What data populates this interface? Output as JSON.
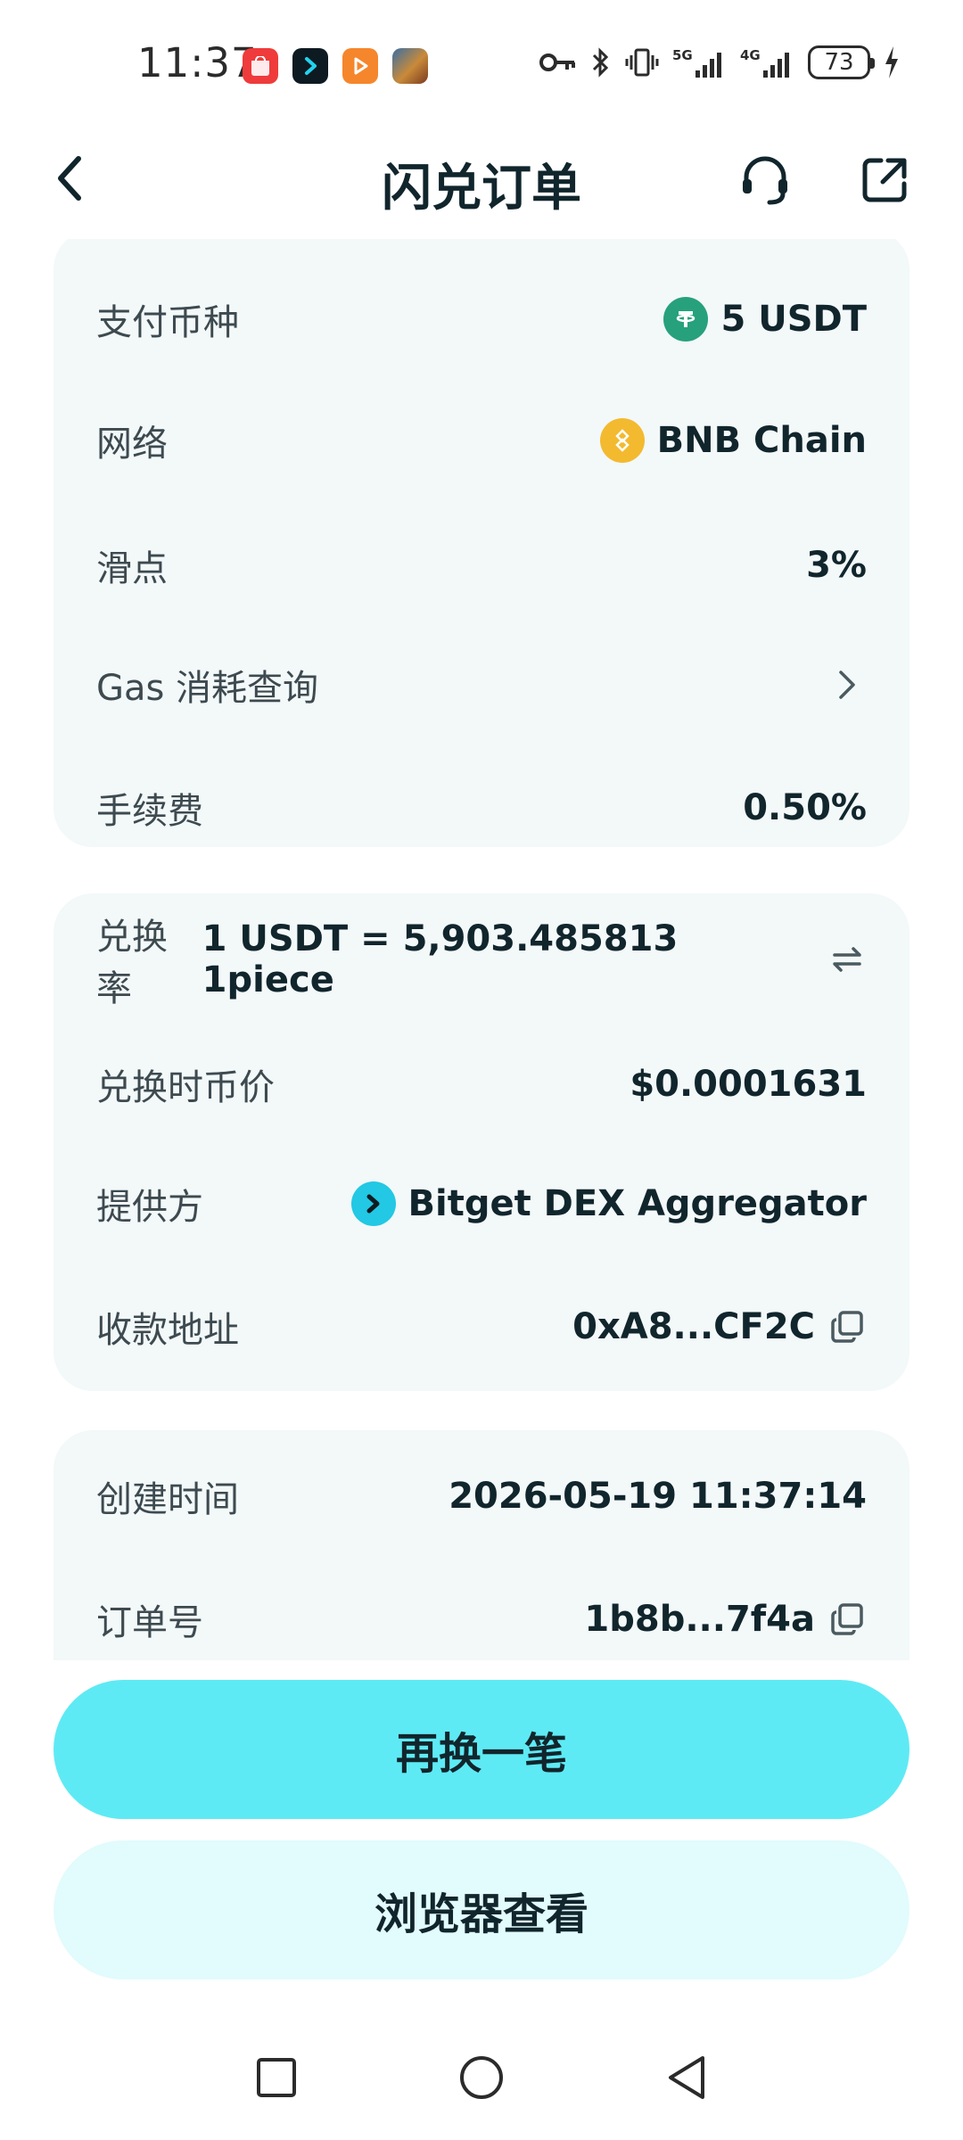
{
  "status_bar": {
    "time": "11:37",
    "battery": "73",
    "network_5g": "5G",
    "network_4g": "4G"
  },
  "header": {
    "title": "闪兑订单"
  },
  "card1": {
    "pay_currency_label": "支付币种",
    "pay_currency_value": "5 USDT",
    "network_label": "网络",
    "network_value": "BNB Chain",
    "slippage_label": "滑点",
    "slippage_value": "3%",
    "gas_label": "Gas 消耗查询",
    "fee_label": "手续费",
    "fee_value": "0.50%"
  },
  "card2": {
    "rate_label": "兑换率",
    "rate_value": "1 USDT = 5,903.485813 1piece",
    "price_label": "兑换时币价",
    "price_value": "$0.0001631",
    "provider_label": "提供方",
    "provider_value": "Bitget DEX Aggregator",
    "address_label": "收款地址",
    "address_value": "0xA8...CF2C"
  },
  "card3": {
    "created_label": "创建时间",
    "created_value": "2026-05-19 11:37:14",
    "order_label": "订单号",
    "order_value": "1b8b...7f4a"
  },
  "buttons": {
    "swap_again": "再换一笔",
    "view_browser": "浏览器查看"
  },
  "colors": {
    "accent": "#5eeaf4",
    "accent_light": "#e2fbfc",
    "card_bg": "#f3f8f9",
    "text": "#11252c"
  }
}
